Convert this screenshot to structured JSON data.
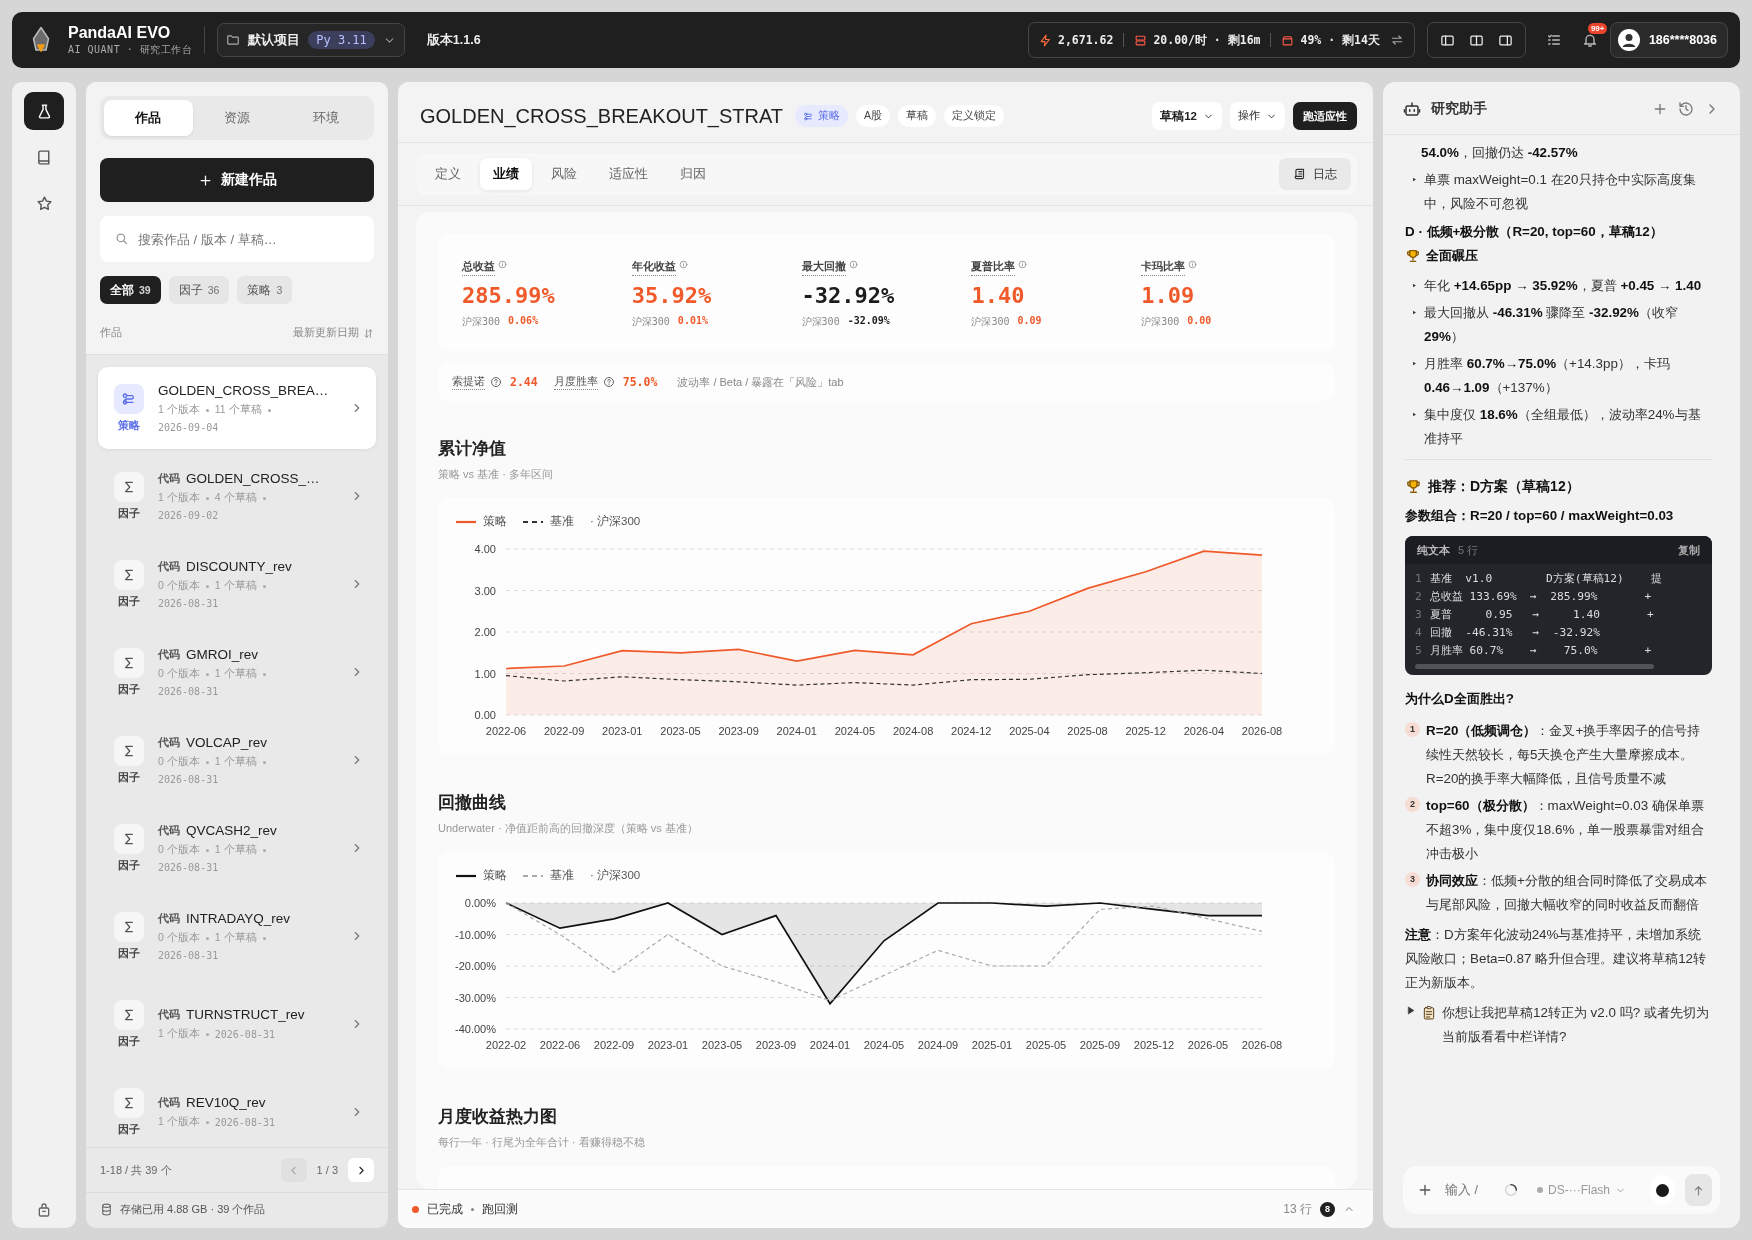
{
  "topbar": {
    "app_name": "PandaAI EVO",
    "app_subtitle": "AI QUANT · 研究工作台",
    "project": {
      "name": "默认项目",
      "python": "Py 3.11"
    },
    "version": "版本1.1.6",
    "stats": [
      {
        "kind": "credits",
        "text": "2,671.62"
      },
      {
        "kind": "rate",
        "text": "20.00/时 · 剩16m"
      },
      {
        "kind": "storage",
        "text": "49% · 剩14天"
      }
    ],
    "notifications": "99+",
    "user": "186****8036"
  },
  "rail": {
    "items": [
      {
        "kind": "lab",
        "selected": true
      },
      {
        "kind": "notebook",
        "selected": false
      },
      {
        "kind": "favorites",
        "selected": false
      }
    ]
  },
  "library": {
    "tabs": [
      {
        "label": "作品",
        "selected": true
      },
      {
        "label": "资源",
        "selected": false
      },
      {
        "label": "环境",
        "selected": false
      }
    ],
    "new_button": "新建作品",
    "search": {
      "placeholder": "搜索作品 / 版本 / 草稿…"
    },
    "filters": [
      {
        "label": "全部",
        "count": "39",
        "selected": true
      },
      {
        "label": "因子",
        "count": "36",
        "selected": false
      },
      {
        "label": "策略",
        "count": "3",
        "selected": false
      }
    ],
    "list_header": {
      "title": "作品",
      "sort": "最新更新日期"
    },
    "items": [
      {
        "kind": "strategy",
        "type": "策略",
        "title": "GOLDEN_CROSS_BREA…",
        "versions": "1 个版本",
        "drafts": "11 个草稿",
        "date": "2026-09-04",
        "selected": true
      },
      {
        "kind": "factor",
        "type": "因子",
        "tag": "代码",
        "title": "GOLDEN_CROSS_…",
        "versions": "1 个版本",
        "drafts": "4 个草稿",
        "date": "2026-09-02",
        "selected": false
      },
      {
        "kind": "factor",
        "type": "因子",
        "tag": "代码",
        "title": "DISCOUNTY_rev",
        "versions": "0 个版本",
        "drafts": "1 个草稿",
        "date": "2026-08-31",
        "selected": false
      },
      {
        "kind": "factor",
        "type": "因子",
        "tag": "代码",
        "title": "GMROI_rev",
        "versions": "0 个版本",
        "drafts": "1 个草稿",
        "date": "2026-08-31",
        "selected": false
      },
      {
        "kind": "factor",
        "type": "因子",
        "tag": "代码",
        "title": "VOLCAP_rev",
        "versions": "0 个版本",
        "drafts": "1 个草稿",
        "date": "2026-08-31",
        "selected": false
      },
      {
        "kind": "factor",
        "type": "因子",
        "tag": "代码",
        "title": "QVCASH2_rev",
        "versions": "0 个版本",
        "drafts": "1 个草稿",
        "date": "2026-08-31",
        "selected": false
      },
      {
        "kind": "factor",
        "type": "因子",
        "tag": "代码",
        "title": "INTRADAYQ_rev",
        "versions": "0 个版本",
        "drafts": "1 个草稿",
        "date": "2026-08-31",
        "selected": false
      },
      {
        "kind": "factor",
        "type": "因子",
        "tag": "代码",
        "title": "TURNSTRUCT_rev",
        "versions": "1 个版本",
        "date": "2026-08-31",
        "selected": false
      },
      {
        "kind": "factor",
        "type": "因子",
        "tag": "代码",
        "title": "REV10Q_rev",
        "versions": "1 个版本",
        "date": "2026-08-31",
        "selected": false
      }
    ],
    "pagination": {
      "range": "1-18 / 共 39 个",
      "page": "1 / 3",
      "prev_disabled": true,
      "next_disabled": false
    },
    "storage": "存储已用 4.88 GB · 39 个作品"
  },
  "detail": {
    "title": "GOLDEN_CROSS_BREAKOUT_STRAT",
    "tags": [
      {
        "kind": "type",
        "label": "策略"
      },
      {
        "kind": "plain",
        "label": "A股"
      },
      {
        "kind": "plain",
        "label": "草稿"
      },
      {
        "kind": "plain",
        "label": "定义锁定"
      }
    ],
    "draft_select": "草稿12",
    "actions_menu": "操作",
    "run_button": "跑适应性",
    "tabs": [
      {
        "label": "定义",
        "selected": false
      },
      {
        "label": "业绩",
        "selected": true
      },
      {
        "label": "风险",
        "selected": false
      },
      {
        "label": "适应性",
        "selected": false
      },
      {
        "label": "归因",
        "selected": false
      }
    ],
    "log_button": "日志",
    "kpis": [
      {
        "label": "总收益",
        "value": "285.99%",
        "highlighted": true,
        "bench_label": "沪深300",
        "bench_value": "0.06%",
        "bench_highlighted": true
      },
      {
        "label": "年化收益",
        "value": "35.92%",
        "highlighted": true,
        "bench_label": "沪深300",
        "bench_value": "0.01%",
        "bench_highlighted": true
      },
      {
        "label": "最大回撤",
        "value": "-32.92%",
        "highlighted": false,
        "bench_label": "沪深300",
        "bench_value": "-32.09%",
        "bench_highlighted": false
      },
      {
        "label": "夏普比率",
        "value": "1.40",
        "highlighted": true,
        "bench_label": "沪深300",
        "bench_value": "0.09",
        "bench_highlighted": true
      },
      {
        "label": "卡玛比率",
        "value": "1.09",
        "highlighted": true,
        "bench_label": "沪深300",
        "bench_value": "0.00",
        "bench_highlighted": true
      }
    ],
    "ratios": [
      {
        "label": "索提诺",
        "value": "2.44"
      },
      {
        "label": "月度胜率",
        "value": "75.0%"
      }
    ],
    "ratio_note": "波动率 / Beta / 暴露在「风险」tab",
    "sections": [
      {
        "kind": "nav",
        "title": "累计净值",
        "subtitle": "策略 vs 基准 · 多年区间",
        "legend_note": "· 沪深300",
        "chart_data": {
          "type": "area",
          "legend": "top-left",
          "grid": true,
          "categories": [
            "2022-06",
            "2022-09",
            "2023-01",
            "2023-05",
            "2023-09",
            "2024-01",
            "2024-05",
            "2024-08",
            "2024-12",
            "2025-04",
            "2025-08",
            "2025-12",
            "2026-04",
            "2026-08"
          ],
          "series": [
            {
              "name": "策略",
              "color": "#f0592a",
              "line_style": "solid",
              "values": [
                1.12,
                1.18,
                1.55,
                1.5,
                1.58,
                1.3,
                1.56,
                1.45,
                2.2,
                2.5,
                3.05,
                3.45,
                3.95,
                3.85
              ]
            },
            {
              "name": "基准",
              "color": "#333333",
              "type": "line",
              "line_style": "dashed",
              "values": [
                0.95,
                0.82,
                0.92,
                0.85,
                0.8,
                0.72,
                0.78,
                0.72,
                0.85,
                0.86,
                0.97,
                1.02,
                1.08,
                1.0
              ]
            }
          ],
          "ylim": [
            0,
            4
          ],
          "yticks": [
            {
              "value": 0,
              "label": "0.00"
            },
            {
              "value": 1,
              "label": "1.00"
            },
            {
              "value": 2,
              "label": "2.00"
            },
            {
              "value": 3,
              "label": "3.00"
            },
            {
              "value": 4,
              "label": "4.00"
            }
          ]
        }
      },
      {
        "kind": "drawdown",
        "title": "回撤曲线",
        "subtitle": "Underwater · 净值距前高的回撤深度（策略 vs 基准）",
        "legend_note": "· 沪深300",
        "chart_data": {
          "type": "area",
          "legend": "top-left",
          "grid": true,
          "categories": [
            "2022-02",
            "2022-06",
            "2022-09",
            "2023-01",
            "2023-05",
            "2023-09",
            "2024-01",
            "2024-05",
            "2024-09",
            "2025-01",
            "2025-05",
            "2025-09",
            "2025-12",
            "2026-05",
            "2026-08"
          ],
          "series": [
            {
              "name": "策略",
              "color": "#111111",
              "line_style": "solid",
              "values": [
                0,
                -8,
                -5,
                0,
                -10,
                -4,
                -32,
                -12,
                0,
                0,
                -1,
                0,
                -2,
                -4,
                -4
              ]
            },
            {
              "name": "基准",
              "color": "#aaaaaa",
              "type": "line",
              "line_style": "dashed",
              "values": [
                0,
                -10,
                -22,
                -10,
                -20,
                -25,
                -31,
                -23,
                -15,
                -20,
                -20,
                -2,
                -1,
                -5,
                -9
              ]
            }
          ],
          "ylim": [
            -40,
            0
          ],
          "yticks": [
            {
              "value": 0,
              "label": "0.00%"
            },
            {
              "value": -10,
              "label": "-10.00%"
            },
            {
              "value": -20,
              "label": "-20.00%"
            },
            {
              "value": -30,
              "label": "-30.00%"
            },
            {
              "value": -40,
              "label": "-40.00%"
            }
          ]
        }
      },
      {
        "kind": "heatmap",
        "title": "月度收益热力图",
        "subtitle": "每行一年 · 行尾为全年合计 · 看赚得稳不稳"
      }
    ],
    "status": {
      "done": true,
      "label": "已完成",
      "task": "跑回测",
      "rows": "13 行",
      "badge": "8"
    }
  },
  "assistant": {
    "title": "研究助手",
    "blocks": [
      {
        "kind": "continuation",
        "text": "**54.0%**，回撤仍达 **-42.57%**"
      },
      {
        "kind": "bullet",
        "text": "单票 maxWeight=0.1 在20只持仓中实际高度集中，风险不可忽视"
      },
      {
        "kind": "heading",
        "text": "D · 低频+极分散（R=20, top=60，草稿12）",
        "suffix": "全面碾压"
      },
      {
        "kind": "bullet",
        "text": "年化 **+14.65pp → 35.92%**，夏普 **+0.45 → 1.40**"
      },
      {
        "kind": "bullet",
        "text": "最大回撤从 **-46.31%** 骤降至 **-32.92%**（收窄**29%**）"
      },
      {
        "kind": "bullet",
        "text": "月胜率 **60.7%→75.0%**（+14.3pp），卡玛 **0.46→1.09**（+137%）"
      },
      {
        "kind": "bullet",
        "text": "集中度仅 **18.6%**（全组最低），波动率24%与基准持平"
      },
      {
        "kind": "divider"
      },
      {
        "kind": "recommend",
        "text": "推荐：D方案（草稿12）"
      },
      {
        "kind": "bold",
        "text": "参数组合：R=20 / top=60 / maxWeight=0.03"
      },
      {
        "kind": "code",
        "label": "纯文本",
        "meta": "5 行",
        "action": "复制",
        "lines": [
          {
            "no": "1",
            "text": "基准  v1.0        D方案(草稿12)    提"
          },
          {
            "no": "2",
            "text": "总收益 133.69%  →  285.99%       +"
          },
          {
            "no": "3",
            "text": "夏普     0.95   →     1.40       +"
          },
          {
            "no": "4",
            "text": "回撤  -46.31%   →  -32.92%"
          },
          {
            "no": "5",
            "text": "月胜率 60.7%    →    75.0%       +"
          }
        ]
      },
      {
        "kind": "bold",
        "text": "为什么D全面胜出?"
      },
      {
        "kind": "numbered",
        "no": "1",
        "text": "**R=20（低频调仓）**：金叉+换手率因子的信号持续性天然较长，每5天换仓产生大量摩擦成本。R=20的换手率大幅降低，且信号质量不减"
      },
      {
        "kind": "numbered",
        "no": "2",
        "text": "**top=60（极分散）**：maxWeight=0.03 确保单票不超3%，集中度仅18.6%，单一股票暴雷对组合冲击极小"
      },
      {
        "kind": "numbered",
        "no": "3",
        "text": "**协同效应**：低频+分散的组合同时降低了交易成本与尾部风险，回撤大幅收窄的同时收益反而翻倍"
      },
      {
        "kind": "paragraph",
        "text": "**注意**：D方案年化波动24%与基准持平，未增加系统风险敞口；Beta=0.87 略升但合理。建议将草稿12转正为新版本。"
      },
      {
        "kind": "question",
        "text": "你想让我把草稿12转正为 v2.0 吗? 或者先切为当前版看看中栏详情?"
      }
    ],
    "input": {
      "placeholder": "输入 /",
      "model": "DS-···Flash"
    }
  }
}
